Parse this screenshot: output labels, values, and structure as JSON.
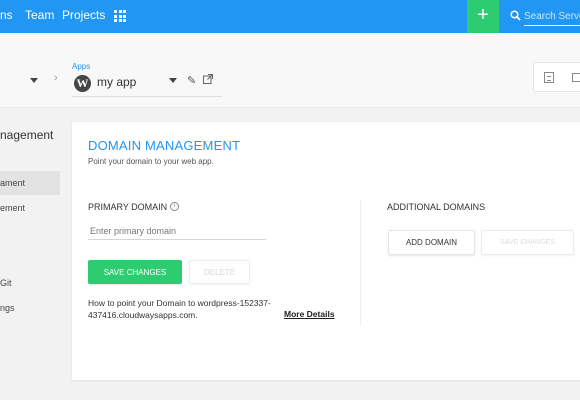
{
  "topbar": {
    "nav": [
      {
        "label": "ns"
      },
      {
        "label": "Team"
      },
      {
        "label": "Projects"
      }
    ],
    "grid_icon": "grid-icon",
    "add_label": "+",
    "search_placeholder": "Search Server o",
    "colors": {
      "bar": "#2196f3",
      "add": "#2ecc71"
    }
  },
  "subheader": {
    "breadcrumb_label": "Apps",
    "app_name": "my app",
    "app_icon": "W",
    "chevron": "›"
  },
  "sidebar": {
    "title": "nagement",
    "items": [
      {
        "label": "ament"
      },
      {
        "label": "ement"
      },
      {
        "label": "Git"
      },
      {
        "label": "ngs"
      }
    ]
  },
  "main": {
    "title": "DOMAIN MANAGEMENT",
    "subtitle": "Point your domain to your web app.",
    "primary_label": "PRIMARY DOMAIN",
    "info_icon": "i",
    "primary_placeholder": "Enter primary domain",
    "save_label": "SAVE CHANGES",
    "delete_label": "DELETE",
    "howto_text": "How to point your Domain to wordpress-152337-437416.cloudwaysapps.com.",
    "more_label": "More Details",
    "additional_label": "ADDITIONAL DOMAINS",
    "add_domain_label": "ADD DOMAIN",
    "save2_label": "SAVE CHANGES"
  }
}
